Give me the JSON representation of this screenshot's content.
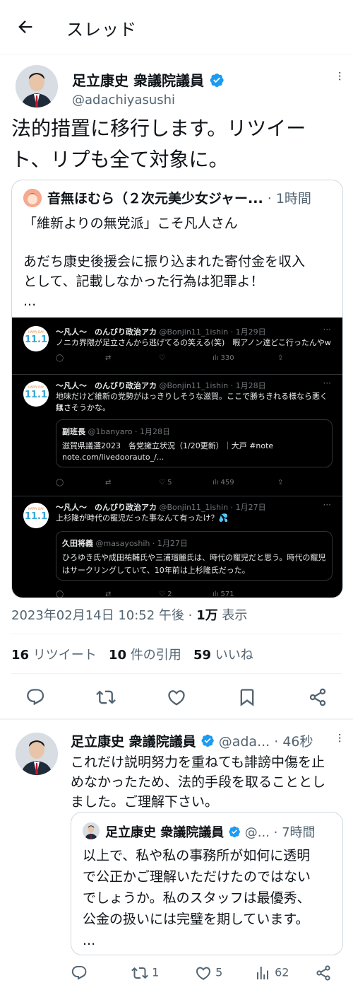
{
  "header": {
    "title": "スレッド"
  },
  "post": {
    "author_name": "足立康史 衆議院議員",
    "author_handle": "@adachiyasushi",
    "text_line1": "法的措置に移行します。リツイー",
    "text_line2": "ト、リプも全て対象に。",
    "quote": {
      "author_name": "音無ほむら（２次元美少女ジャー...",
      "time": "· 1時間",
      "line1": "「維新よりの無党派」こそ凡人さん",
      "line2": "あだち康史後援会に振り込まれた寄付金を収入",
      "line3": "として、記載しなかった行為は犯罪よ！",
      "ellipsis": "...",
      "screenshot": {
        "posts": [
          {
            "name": "〜凡人〜　のんびり政治アカ",
            "handle": "@Bonjin11_1ishin · 1月29日",
            "avatar_text": "11.1",
            "avatar_top": "HAPPY DAY",
            "avatar_bottom": "Hello Uh!",
            "body": "ノニカ界隈が足立さんから逃げてるの笑える(笑)　暇アノン達どこ行ったんやw",
            "views": "330"
          },
          {
            "name": "〜凡人〜　のんびり政治アカ",
            "handle": "@Bonjin11_1ishin · 1月28日",
            "avatar_text": "11.1",
            "avatar_top": "HAPPY DAY",
            "avatar_bottom": "Hello Uh!",
            "body1": "地味だけど維新の党勢がはっきりしそうな滋賀。ここで勝ちきれる様なら悪くは",
            "body2": "無さそうかな。",
            "quote_name": "副班長",
            "quote_handle": "@1banyaro · 1月28日",
            "quote_line1": "滋賀県議選2023　各党擁立状況（1/20更新）｜大戸 #note",
            "quote_line2": "note.com/livedoorauto_/...",
            "likes": "5",
            "views": "459"
          },
          {
            "name": "〜凡人〜　のんびり政治アカ",
            "handle": "@Bonjin11_1ishin · 1月27日",
            "avatar_text": "11.1",
            "avatar_top": "HAPPY DAY",
            "avatar_bottom": "Hello Uh!",
            "body": "上杉隆が時代の寵児だった事なんて有ったけ？💦",
            "quote_name": "久田将義",
            "quote_handle": "@masayoshih · 1月27日",
            "quote_line1": "ひろゆき氏や成田祐輔氏や三浦瑠麗氏は、時代の寵児だと思う。時代の寵児",
            "quote_line2": "はサークリングしていて、10年前は上杉隆氏だった。",
            "likes": "2",
            "views": "571"
          }
        ]
      }
    },
    "timestamp": "2023年02月14日 10:52 午後 · ",
    "views_count": "1万",
    "views_label": " 表示",
    "retweets_count": "16",
    "retweets_label": " リツイート",
    "quotes_count": "10",
    "quotes_label": " 件の引用",
    "likes_count": "59",
    "likes_label": " いいね"
  },
  "reply": {
    "author_name": "足立康史 衆議院議員",
    "handle_time": "@ada...",
    "time": "· 46秒",
    "line1": "これだけ説明努力を重ねても誹謗中傷を止",
    "line2": "めなかったため、法的手段を取ることとし",
    "line3": "ました。ご理解下さい。",
    "quote": {
      "author_name": "足立康史 衆議院議員",
      "handle": "@...",
      "time": "· 7時間",
      "line1": "以上で、私や私の事務所が如何に透明",
      "line2": "で公正かご理解いただけたのではない",
      "line3": "でしょうか。私のスタッフは最優秀、",
      "line4": "公金の扱いには完璧を期しています。",
      "ellipsis": "..."
    },
    "retweets": "1",
    "likes": "5",
    "views": "62"
  },
  "colors": {
    "accent": "#1d9bf0",
    "text": "#0f1419",
    "muted": "#536471",
    "border": "#cfd9de"
  }
}
